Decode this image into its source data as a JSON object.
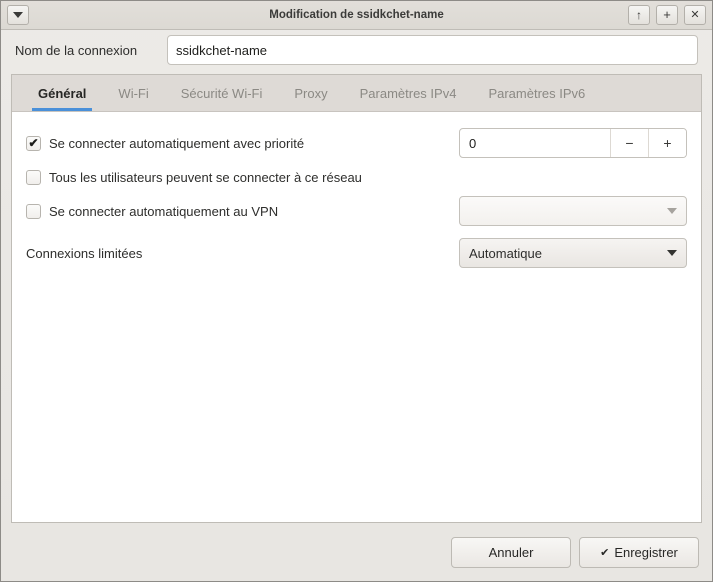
{
  "window": {
    "title": "Modification de ssidkchet-name",
    "menu_icon": "triangle-down-icon",
    "buttons": [
      {
        "name": "shade-button",
        "icon": "arrow-up-icon"
      },
      {
        "name": "maximize-button",
        "icon": "plus-icon"
      },
      {
        "name": "close-button",
        "icon": "close-x-icon"
      }
    ]
  },
  "connection": {
    "name_label": "Nom de la connexion",
    "name_value": "ssidkchet-name",
    "name_placeholder": ""
  },
  "tabs": [
    {
      "label": "Général",
      "active": true
    },
    {
      "label": "Wi-Fi",
      "active": false
    },
    {
      "label": "Sécurité Wi-Fi",
      "active": false
    },
    {
      "label": "Proxy",
      "active": false
    },
    {
      "label": "Paramètres IPv4",
      "active": false
    },
    {
      "label": "Paramètres IPv6",
      "active": false
    }
  ],
  "general": {
    "autoconnect": {
      "label": "Se connecter automatiquement avec priorité",
      "checked": true,
      "check_glyph": "✔",
      "priority_value": "0",
      "minus_glyph": "−",
      "plus_glyph": "+"
    },
    "all_users": {
      "label": "Tous les utilisateurs peuvent se connecter à ce réseau",
      "checked": false
    },
    "vpn": {
      "label": "Se connecter automatiquement au VPN",
      "checked": false,
      "combo_value": ""
    },
    "metered": {
      "label": "Connexions limitées",
      "combo_value": "Automatique"
    }
  },
  "actions": {
    "cancel_label": "Annuler",
    "save_label": "Enregistrer",
    "save_glyph": "✔"
  },
  "colors": {
    "accent": "#4a90d9",
    "titlebar": "#dedbd6",
    "tabbar": "#dedad6",
    "content": "#ffffff"
  }
}
